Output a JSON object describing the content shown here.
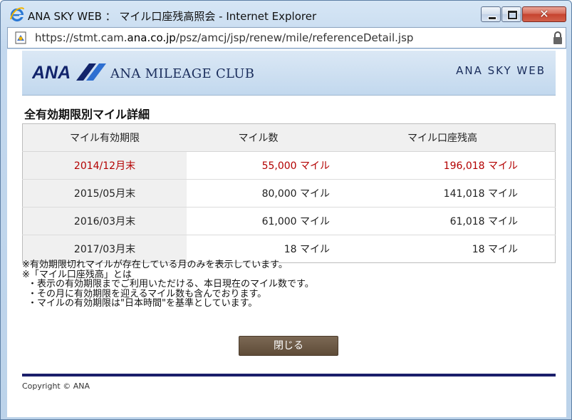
{
  "window": {
    "title": "ANA SKY WEB ： マイル口座残高照会 - Internet Explorer",
    "close_glyph": "✕"
  },
  "address": {
    "url_prefix": "https://stmt.cam.",
    "url_domain": "ana.co.jp",
    "url_path": "/psz/amcj/jsp/renew/mile/referenceDetail.jsp"
  },
  "header": {
    "logo_text": "ANA",
    "club_name": "ANA MILEAGE CLUB",
    "site_name": "ANA SKY WEB"
  },
  "page": {
    "title": "全有効期限別マイル詳細"
  },
  "table": {
    "headers": [
      "マイル有効期限",
      "マイル数",
      "マイル口座残高"
    ],
    "rows": [
      {
        "date": "2014/12月末",
        "miles": "55,000 マイル",
        "balance": "196,018 マイル",
        "highlight": true
      },
      {
        "date": "2015/05月末",
        "miles": "80,000 マイル",
        "balance": "141,018 マイル",
        "highlight": false
      },
      {
        "date": "2016/03月末",
        "miles": "61,000 マイル",
        "balance": "61,018 マイル",
        "highlight": false
      },
      {
        "date": "2017/03月末",
        "miles": "18 マイル",
        "balance": "18 マイル",
        "highlight": false
      }
    ]
  },
  "notes": [
    "※有効期限切れマイルが存在している月のみを表示しています。",
    "※「マイル口座残高」とは",
    "・表示の有効期限までご利用いただける、本日現在のマイル数です。",
    "・その月に有効期限を迎えるマイル数も含んでおります。",
    "・マイルの有効期限は\"日本時間\"を基準としています。"
  ],
  "buttons": {
    "close_label": "閉じる"
  },
  "footer": {
    "copyright": "Copyright © ANA"
  },
  "colors": {
    "highlight_red": "#b30000",
    "footer_navy": "#1b1f6b",
    "close_button_brown": "#6e5a45"
  }
}
